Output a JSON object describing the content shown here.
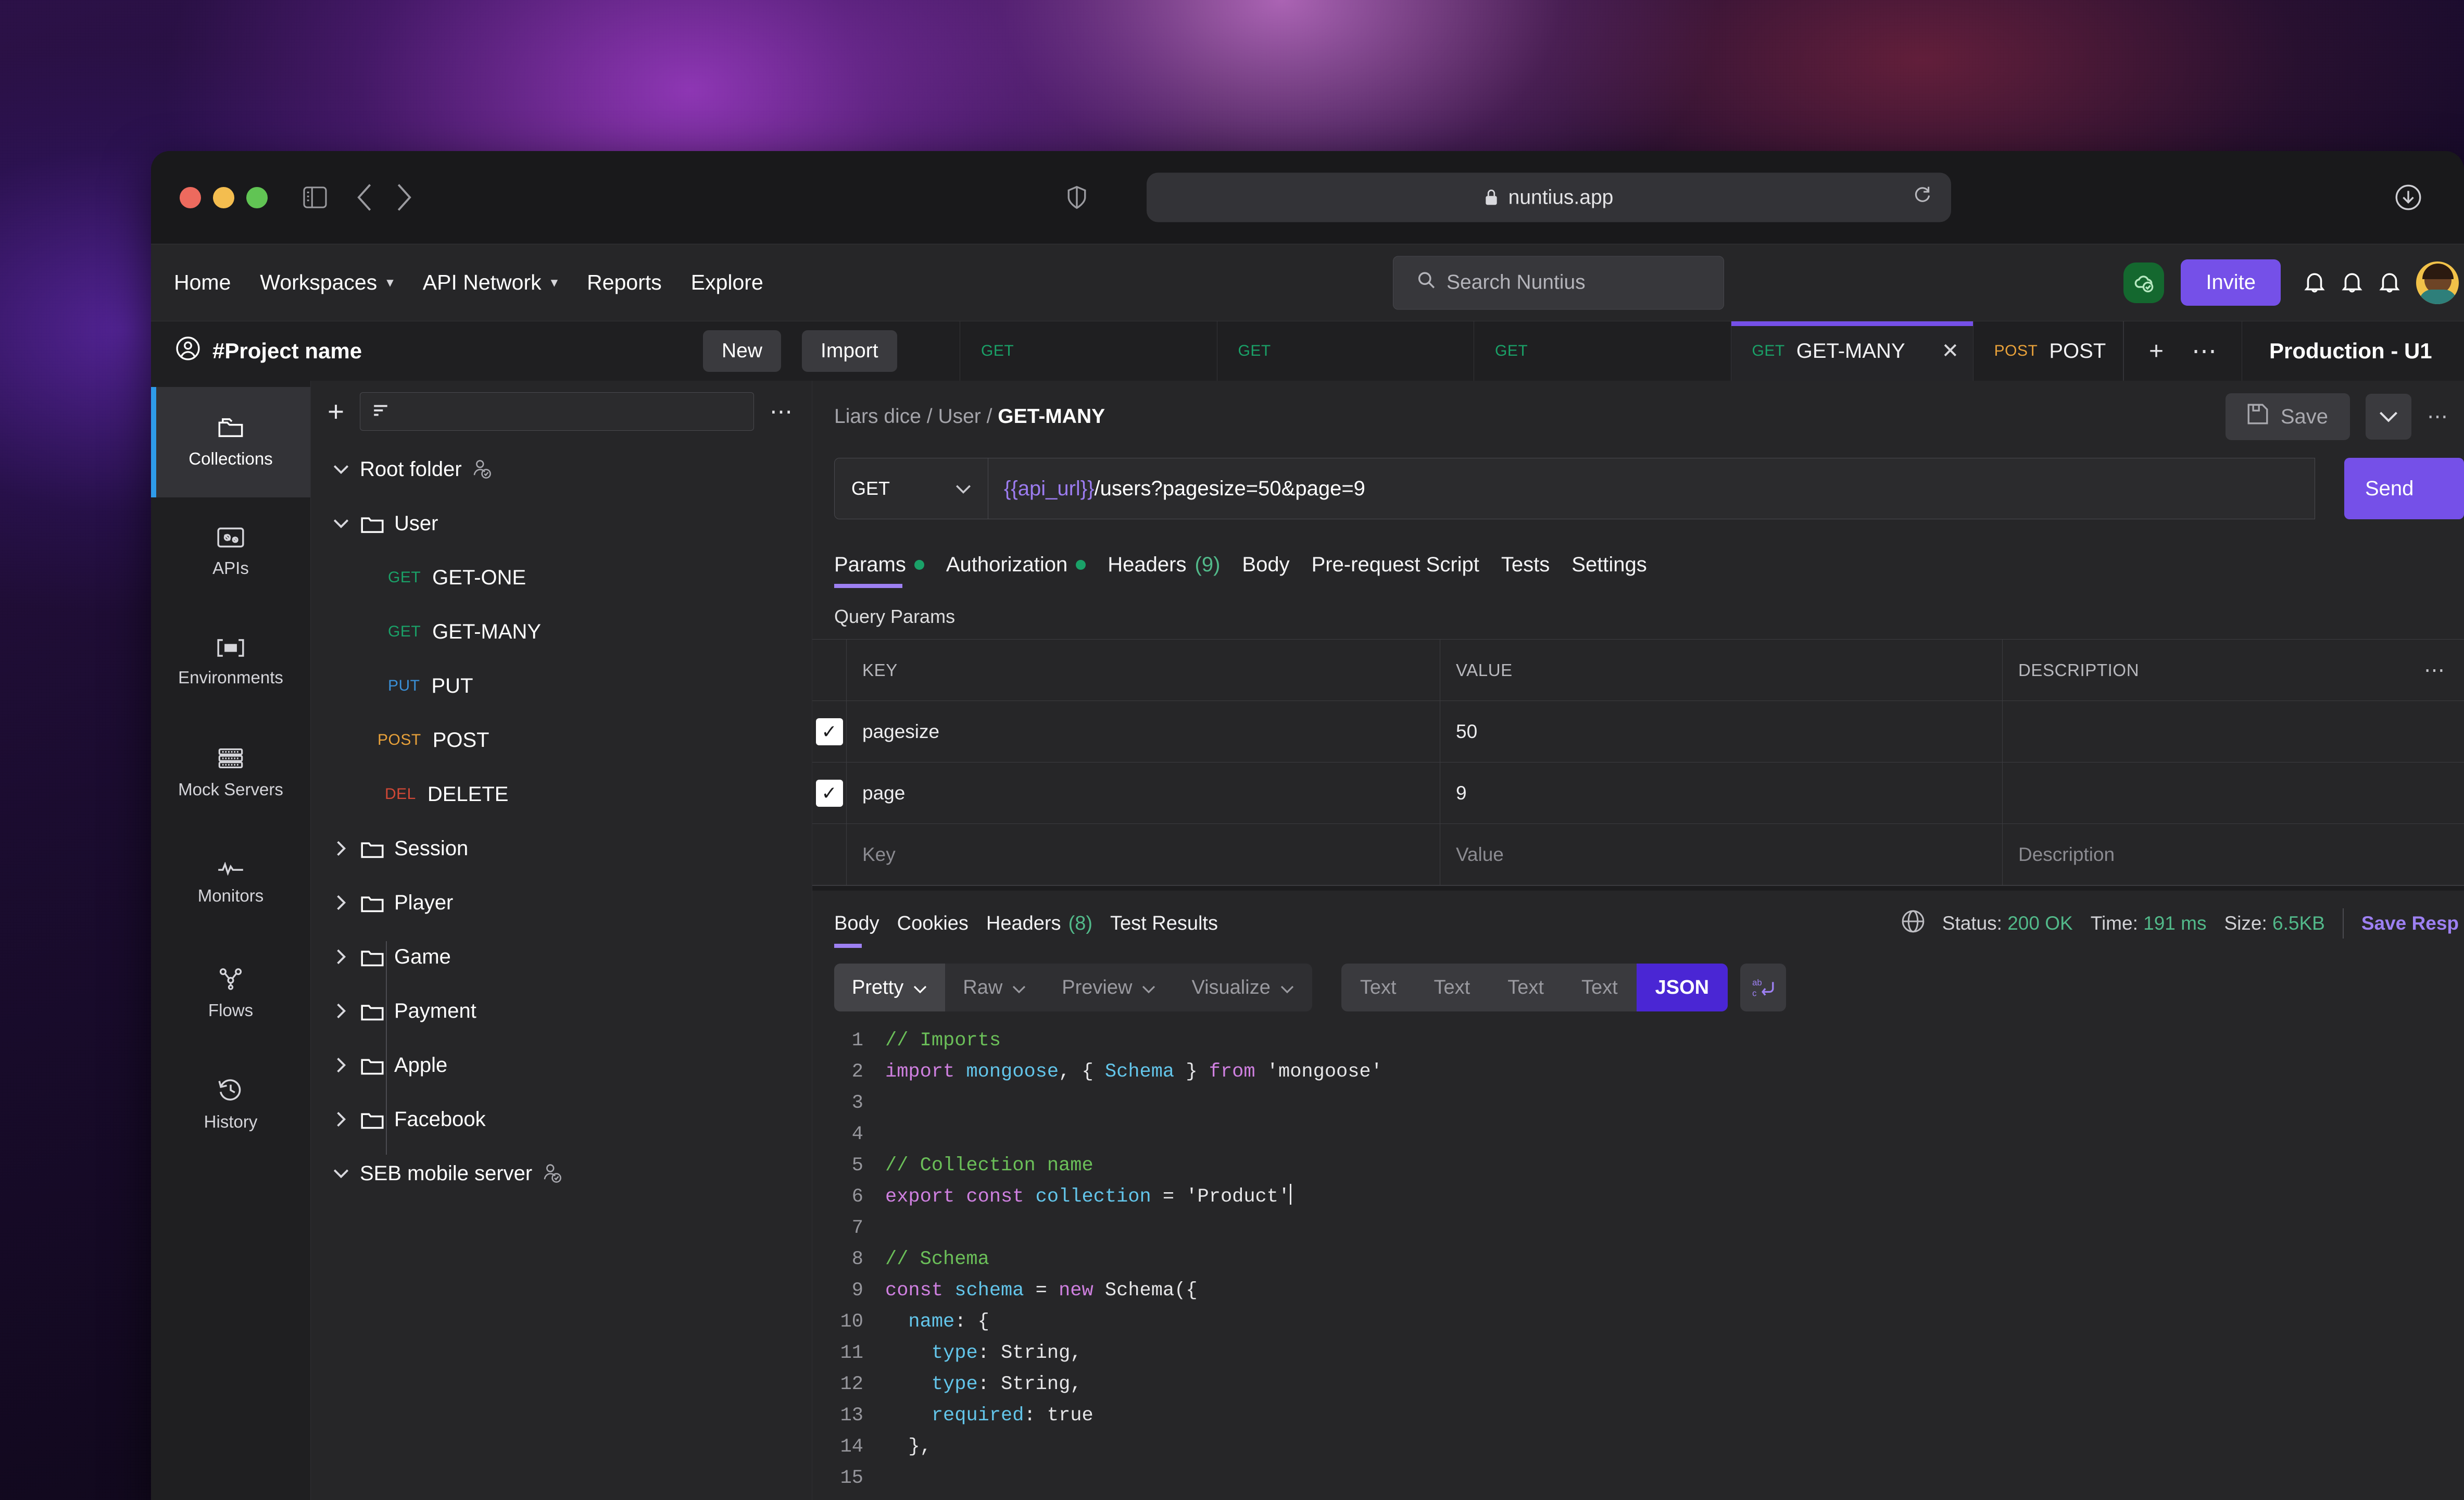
{
  "browser": {
    "url": "nuntius.app",
    "lock_icon": "lock-icon",
    "reload_icon": "reload-icon",
    "download_icon": "download-icon",
    "shield_icon": "shield-icon",
    "sidebar_icon": "sidebar-toggle-icon",
    "back_icon": "chevron-left-icon",
    "forward_icon": "chevron-right-icon"
  },
  "header": {
    "nav": [
      {
        "label": "Home",
        "has_caret": false
      },
      {
        "label": "Workspaces",
        "has_caret": true
      },
      {
        "label": "API Network",
        "has_caret": true
      },
      {
        "label": "Reports",
        "has_caret": false
      },
      {
        "label": "Explore",
        "has_caret": false
      }
    ],
    "search_placeholder": "Search Nuntius",
    "invite_label": "Invite",
    "cloud_icon": "cloud-check-icon",
    "bell_icon": "bell-icon",
    "avatar": "user-avatar"
  },
  "workspace": {
    "project_name": "#Project name",
    "new_label": "New",
    "import_label": "Import",
    "environment": "Production - U1",
    "add_tab_icon": "plus-icon",
    "tab_more_icon": "ellipsis-icon",
    "tabs": [
      {
        "method": "GET",
        "method_class": "get",
        "label": "",
        "active": false,
        "closable": false
      },
      {
        "method": "GET",
        "method_class": "get",
        "label": "",
        "active": false,
        "closable": false
      },
      {
        "method": "GET",
        "method_class": "get",
        "label": "",
        "active": false,
        "closable": false
      },
      {
        "method": "GET",
        "method_class": "get",
        "label": "GET-MANY",
        "active": true,
        "closable": true
      },
      {
        "method": "POST",
        "method_class": "post",
        "label": "POST",
        "active": false,
        "closable": false
      }
    ]
  },
  "rail": {
    "items": [
      {
        "label": "Collections",
        "icon": "collections-icon",
        "active": true
      },
      {
        "label": "APIs",
        "icon": "apis-icon",
        "active": false
      },
      {
        "label": "Environments",
        "icon": "environments-icon",
        "active": false
      },
      {
        "label": "Mock Servers",
        "icon": "mock-servers-icon",
        "active": false
      },
      {
        "label": "Monitors",
        "icon": "monitors-icon",
        "active": false
      },
      {
        "label": "Flows",
        "icon": "flows-icon",
        "active": false
      },
      {
        "label": "History",
        "icon": "history-icon",
        "active": false
      }
    ]
  },
  "tree": {
    "add_icon": "plus-icon",
    "filter_icon": "filter-icon",
    "more_icon": "ellipsis-icon",
    "rows": [
      {
        "type": "collection",
        "label": "Root folder",
        "expanded": true,
        "shared": true
      },
      {
        "type": "folder",
        "label": "User",
        "expanded": true,
        "shared": false
      },
      {
        "type": "request",
        "label": "GET-ONE",
        "method": "GET",
        "method_class": "get"
      },
      {
        "type": "request",
        "label": "GET-MANY",
        "method": "GET",
        "method_class": "get"
      },
      {
        "type": "request",
        "label": "PUT",
        "method": "PUT",
        "method_class": "put"
      },
      {
        "type": "request",
        "label": "POST",
        "method": "POST",
        "method_class": "post"
      },
      {
        "type": "request",
        "label": "DELETE",
        "method": "DEL",
        "method_class": "del"
      },
      {
        "type": "folder",
        "label": "Session",
        "expanded": false,
        "shared": false
      },
      {
        "type": "folder",
        "label": "Player",
        "expanded": false,
        "shared": false
      },
      {
        "type": "folder",
        "label": "Game",
        "expanded": false,
        "shared": false
      },
      {
        "type": "folder",
        "label": "Payment",
        "expanded": false,
        "shared": false
      },
      {
        "type": "folder",
        "label": "Apple",
        "expanded": false,
        "shared": false
      },
      {
        "type": "folder",
        "label": "Facebook",
        "expanded": false,
        "shared": false
      },
      {
        "type": "collection",
        "label": "SEB mobile server",
        "expanded": true,
        "shared": true
      }
    ]
  },
  "request": {
    "breadcrumb_parts": [
      "Liars dice",
      "User"
    ],
    "breadcrumb_current": "GET-MANY",
    "save_label": "Save",
    "save_icon": "floppy-disk-icon",
    "save_caret_icon": "chevron-down-icon",
    "more_icon": "ellipsis-icon",
    "method": "GET",
    "method_caret_icon": "chevron-down-icon",
    "url_variable": "{{api_url}}",
    "url_rest": "/users?pagesize=50&page=9",
    "send_label": "Send",
    "tabs": [
      {
        "label": "Params",
        "active": true,
        "dot": true,
        "count": ""
      },
      {
        "label": "Authorization",
        "active": false,
        "dot": true,
        "count": ""
      },
      {
        "label": "Headers",
        "active": false,
        "dot": false,
        "count": "(9)"
      },
      {
        "label": "Body",
        "active": false,
        "dot": false,
        "count": ""
      },
      {
        "label": "Pre-request Script",
        "active": false,
        "dot": false,
        "count": ""
      },
      {
        "label": "Tests",
        "active": false,
        "dot": false,
        "count": ""
      },
      {
        "label": "Settings",
        "active": false,
        "dot": false,
        "count": ""
      }
    ],
    "query_params_label": "Query Params",
    "table": {
      "headers": {
        "key": "KEY",
        "value": "VALUE",
        "description": "DESCRIPTION"
      },
      "more_icon": "ellipsis-icon",
      "rows": [
        {
          "checked": true,
          "key": "pagesize",
          "value": "50",
          "description": ""
        },
        {
          "checked": true,
          "key": "page",
          "value": "9",
          "description": ""
        }
      ],
      "placeholder_row": {
        "key": "Key",
        "value": "Value",
        "description": "Description"
      }
    }
  },
  "response": {
    "tabs": [
      {
        "label": "Body",
        "active": true,
        "count": ""
      },
      {
        "label": "Cookies",
        "active": false,
        "count": ""
      },
      {
        "label": "Headers",
        "active": false,
        "count": "(8)"
      },
      {
        "label": "Test Results",
        "active": false,
        "count": ""
      }
    ],
    "globe_icon": "globe-icon",
    "status_label": "Status:",
    "status_value": "200 OK",
    "time_label": "Time:",
    "time_value": "191 ms",
    "size_label": "Size:",
    "size_value": "6.5KB",
    "save_response_label": "Save Resp",
    "format_modes": [
      {
        "label": "Pretty",
        "active": true,
        "caret": true
      },
      {
        "label": "Raw",
        "active": false,
        "caret": true
      },
      {
        "label": "Preview",
        "active": false,
        "caret": true
      },
      {
        "label": "Visualize",
        "active": false,
        "caret": true
      }
    ],
    "type_toggles": [
      {
        "label": "Text",
        "active": false
      },
      {
        "label": "Text",
        "active": false
      },
      {
        "label": "Text",
        "active": false
      },
      {
        "label": "Text",
        "active": false
      },
      {
        "label": "JSON",
        "active": true
      }
    ],
    "wrap_icon": "word-wrap-icon",
    "code_lines": [
      {
        "n": "1",
        "tokens": [
          {
            "t": "// Imports",
            "c": "c-com"
          }
        ]
      },
      {
        "n": "2",
        "tokens": [
          {
            "t": "import ",
            "c": "c-kw"
          },
          {
            "t": "mongoose",
            "c": "c-var"
          },
          {
            "t": ", { ",
            "c": "c-pln"
          },
          {
            "t": "Schema",
            "c": "c-var"
          },
          {
            "t": " } ",
            "c": "c-pln"
          },
          {
            "t": "from ",
            "c": "c-kw"
          },
          {
            "t": "'mongoose'",
            "c": "c-str"
          }
        ]
      },
      {
        "n": "3",
        "tokens": []
      },
      {
        "n": "4",
        "tokens": []
      },
      {
        "n": "5",
        "tokens": [
          {
            "t": "// Collection name",
            "c": "c-com"
          }
        ]
      },
      {
        "n": "6",
        "tokens": [
          {
            "t": "export const ",
            "c": "c-kw"
          },
          {
            "t": "collection",
            "c": "c-var"
          },
          {
            "t": " = ",
            "c": "c-pln"
          },
          {
            "t": "'Product'",
            "c": "c-str"
          }
        ],
        "cursor": true
      },
      {
        "n": "7",
        "tokens": []
      },
      {
        "n": "8",
        "tokens": [
          {
            "t": "// Schema",
            "c": "c-com"
          }
        ]
      },
      {
        "n": "9",
        "tokens": [
          {
            "t": "const ",
            "c": "c-kw"
          },
          {
            "t": "schema",
            "c": "c-var"
          },
          {
            "t": " = ",
            "c": "c-pln"
          },
          {
            "t": "new ",
            "c": "c-kw"
          },
          {
            "t": "Schema({",
            "c": "c-pln"
          }
        ]
      },
      {
        "n": "10",
        "tokens": [
          {
            "t": "  ",
            "c": "c-pln"
          },
          {
            "t": "name",
            "c": "c-var"
          },
          {
            "t": ": {",
            "c": "c-pln"
          }
        ]
      },
      {
        "n": "11",
        "tokens": [
          {
            "t": "    ",
            "c": "c-pln"
          },
          {
            "t": "type",
            "c": "c-var"
          },
          {
            "t": ": String,",
            "c": "c-pln"
          }
        ]
      },
      {
        "n": "12",
        "tokens": [
          {
            "t": "    ",
            "c": "c-pln"
          },
          {
            "t": "type",
            "c": "c-var"
          },
          {
            "t": ": String,",
            "c": "c-pln"
          }
        ]
      },
      {
        "n": "13",
        "tokens": [
          {
            "t": "    ",
            "c": "c-pln"
          },
          {
            "t": "required",
            "c": "c-var"
          },
          {
            "t": ": true",
            "c": "c-pln"
          }
        ]
      },
      {
        "n": "14",
        "tokens": [
          {
            "t": "  },",
            "c": "c-pln"
          }
        ]
      },
      {
        "n": "15",
        "tokens": []
      }
    ]
  }
}
